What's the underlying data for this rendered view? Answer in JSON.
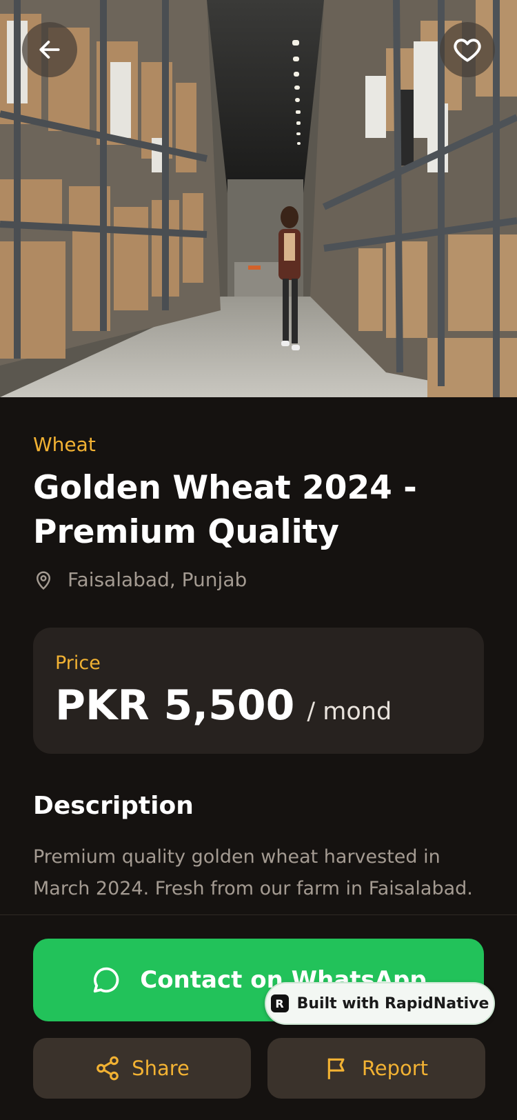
{
  "hero": {
    "image_alt": "warehouse aisle photo",
    "back_icon": "arrow-left-icon",
    "favorite_icon": "heart-icon"
  },
  "listing": {
    "category": "Wheat",
    "title": "Golden Wheat 2024 - Premium Quality",
    "location_icon": "map-pin-icon",
    "location": "Faisalabad, Punjab"
  },
  "price": {
    "label": "Price",
    "value": "PKR 5,500",
    "unit": "/ mond"
  },
  "description": {
    "heading": "Description",
    "text": "Premium quality golden wheat harvested in March 2024. Fresh from our farm in Faisalabad."
  },
  "actions": {
    "whatsapp_label": "Contact on WhatsApp",
    "whatsapp_icon": "chat-bubble-icon",
    "share_label": "Share",
    "share_icon": "share-icon",
    "report_label": "Report",
    "report_icon": "flag-icon"
  },
  "badge": {
    "logo_letter": "R",
    "text": "Built with RapidNative"
  },
  "colors": {
    "accent": "#F2B233",
    "whatsapp_green": "#22C25A",
    "background": "#151210",
    "card": "#27221F",
    "secondary_button": "#3A322B"
  }
}
